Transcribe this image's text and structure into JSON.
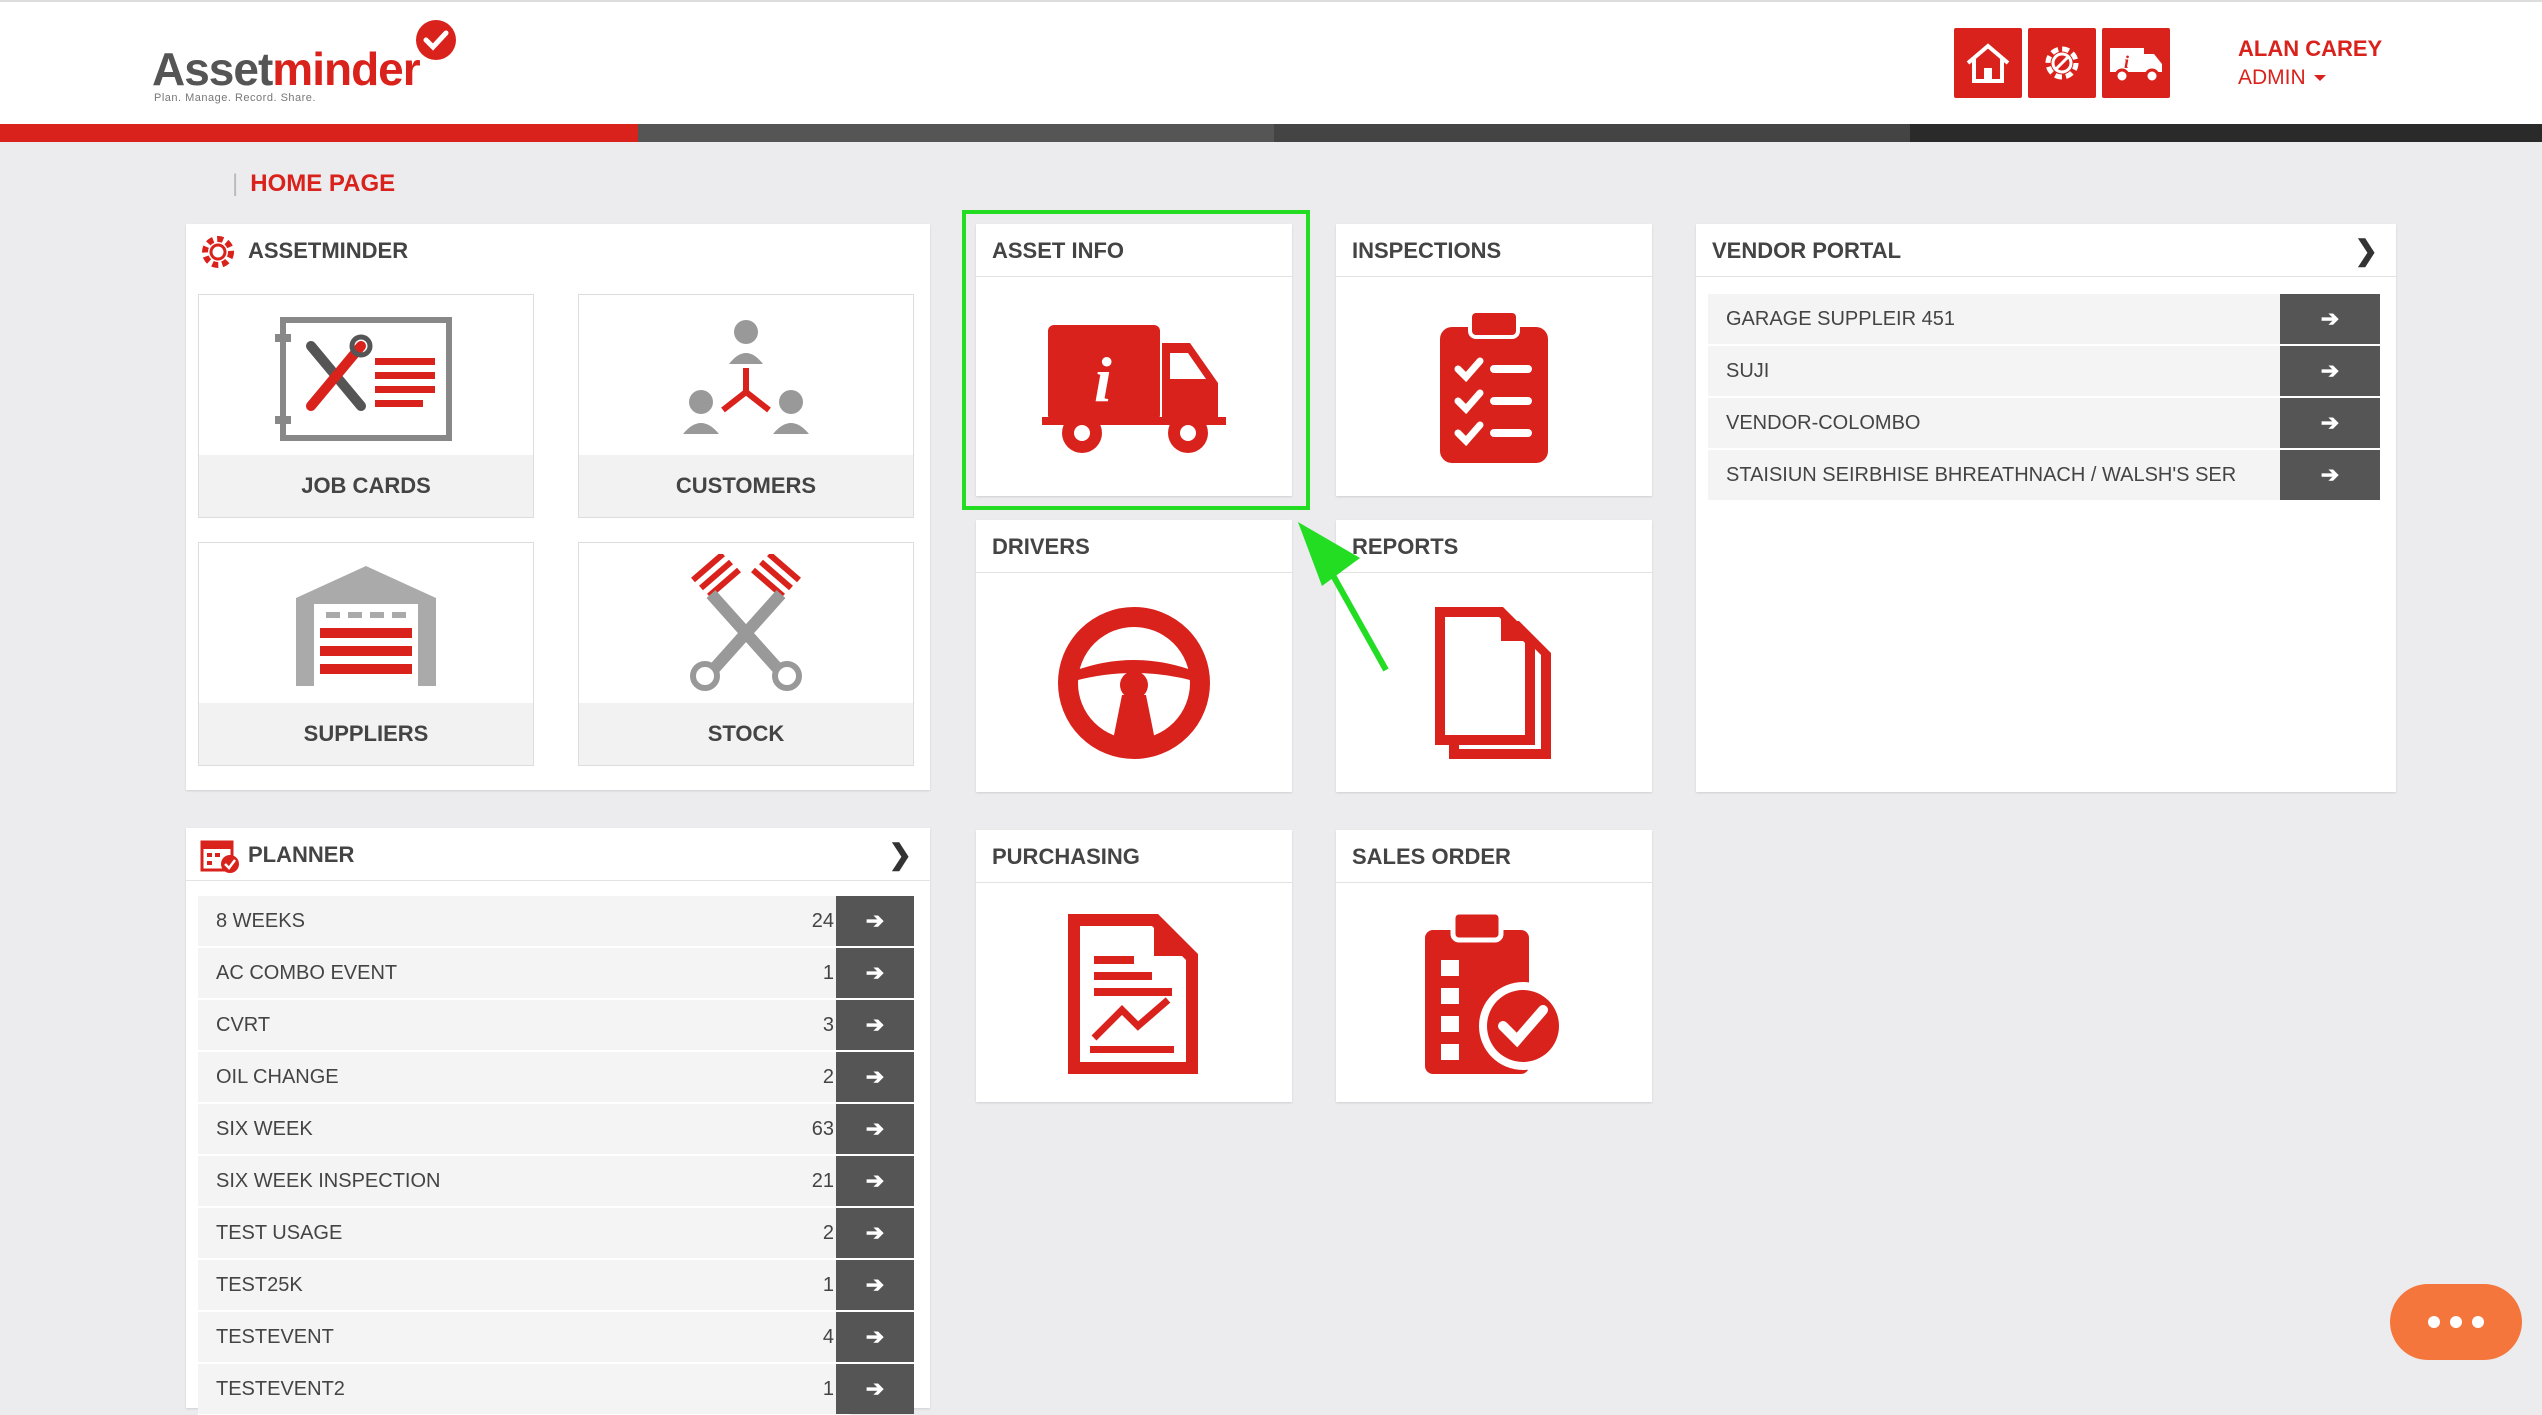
{
  "app": {
    "logo_main": "Asset",
    "logo_accent": "minder",
    "logo_tagline": "Plan. Manage. Record. Share."
  },
  "header": {
    "buttons": [
      {
        "icon": "home-icon"
      },
      {
        "icon": "gear-icon"
      },
      {
        "icon": "truck-info-icon"
      }
    ],
    "user_name": "ALAN CAREY",
    "user_role": "ADMIN"
  },
  "breadcrumb": {
    "label": "HOME PAGE"
  },
  "assetminder_panel": {
    "title": "ASSETMINDER",
    "tiles": [
      {
        "label": "JOB CARDS",
        "icon": "job-cards-icon"
      },
      {
        "label": "CUSTOMERS",
        "icon": "customers-icon"
      },
      {
        "label": "SUPPLIERS",
        "icon": "warehouse-icon"
      },
      {
        "label": "STOCK",
        "icon": "pistons-icon"
      }
    ]
  },
  "modules": [
    {
      "title": "ASSET INFO",
      "icon": "truck-info-icon"
    },
    {
      "title": "INSPECTIONS",
      "icon": "clipboard-checklist-icon"
    },
    {
      "title": "DRIVERS",
      "icon": "steering-wheel-icon"
    },
    {
      "title": "REPORTS",
      "icon": "documents-icon"
    },
    {
      "title": "PURCHASING",
      "icon": "report-chart-icon"
    },
    {
      "title": "SALES ORDER",
      "icon": "clipboard-check-icon"
    }
  ],
  "vendor_portal": {
    "title": "VENDOR PORTAL",
    "items": [
      {
        "label": "GARAGE SUPPLEIR 451"
      },
      {
        "label": "SUJI"
      },
      {
        "label": "VENDOR-COLOMBO"
      },
      {
        "label": "STAISIUN SEIRBHISE BHREATHNACH / WALSH'S SER"
      }
    ]
  },
  "planner": {
    "title": "PLANNER",
    "items": [
      {
        "label": "8 WEEKS",
        "count": "24"
      },
      {
        "label": "AC COMBO EVENT",
        "count": "1"
      },
      {
        "label": "CVRT",
        "count": "3"
      },
      {
        "label": "OIL CHANGE",
        "count": "2"
      },
      {
        "label": "SIX WEEK",
        "count": "63"
      },
      {
        "label": "SIX WEEK INSPECTION",
        "count": "21"
      },
      {
        "label": "TEST USAGE",
        "count": "2"
      },
      {
        "label": "TEST25K",
        "count": "1"
      },
      {
        "label": "TESTEVENT",
        "count": "4"
      },
      {
        "label": "TESTEVENT2",
        "count": "1"
      }
    ]
  },
  "colors": {
    "brand_red": "#d9221c",
    "highlight_green": "#22dd22",
    "chat_orange": "#f4763c"
  }
}
